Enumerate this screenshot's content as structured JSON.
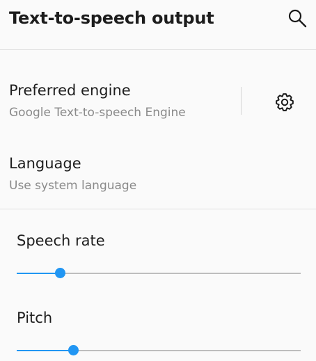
{
  "header": {
    "title": "Text-to-speech output",
    "search_icon": "search-icon"
  },
  "preferred_engine": {
    "title": "Preferred engine",
    "subtitle": "Google Text-to-speech Engine",
    "settings_icon": "gear-icon"
  },
  "language": {
    "title": "Language",
    "subtitle": "Use system language"
  },
  "speech_rate": {
    "label": "Speech rate",
    "value_fraction": 0.152
  },
  "pitch": {
    "label": "Pitch",
    "value_fraction": 0.199
  },
  "colors": {
    "accent": "#2196f3",
    "track": "#bdbdbd",
    "divider": "#dedede",
    "subtitle": "#8a8a8a"
  }
}
